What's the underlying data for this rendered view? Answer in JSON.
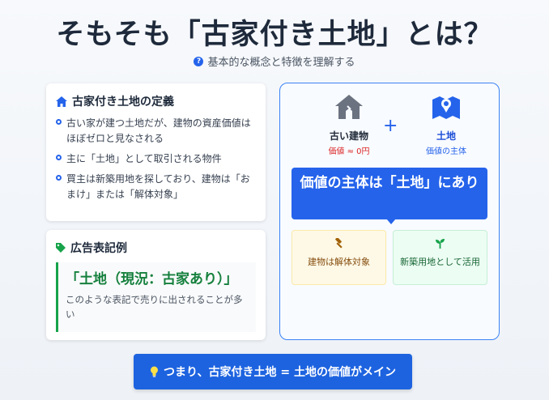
{
  "header": {
    "title": "そもそも「古家付き土地」とは？",
    "subtitle": "基本的な概念と特徴を理解する",
    "subtitle_icon": "question-circle-icon"
  },
  "definition": {
    "heading": "古家付き土地の定義",
    "icon": "home-icon",
    "bullets": [
      "古い家が建つ土地だが、建物の資産価値はほぼゼロと見なされる",
      "主に「土地」として取引される物件",
      "買主は新築用地を探しており、建物は「おまけ」または「解体対象」"
    ]
  },
  "ad_example": {
    "heading": "広告表記例",
    "icon": "tag-icon",
    "example": "「土地（現況：古家あり）」",
    "note": "このような表記で売りに出されることが多い"
  },
  "diagram": {
    "house_label": "古い建物",
    "house_value": "価値 ≈ 0円",
    "house_icon": "house-icon",
    "plus": "+",
    "land_label": "土地",
    "land_value": "価値の主体",
    "land_icon": "map-location-icon",
    "banner": "価値の主体は「土地」にあり",
    "option_demolish": "建物は解体対象",
    "option_demolish_icon": "hammer-icon",
    "option_newbuild": "新築用地として活用",
    "option_newbuild_icon": "seedling-icon"
  },
  "footer": {
    "icon": "lightbulb-icon",
    "text": "つまり、古家付き土地 = 土地の価値がメイン"
  },
  "colors": {
    "primary": "#2563eb",
    "green": "#16a34a",
    "red": "#dc2626",
    "amber": "#a16207"
  }
}
